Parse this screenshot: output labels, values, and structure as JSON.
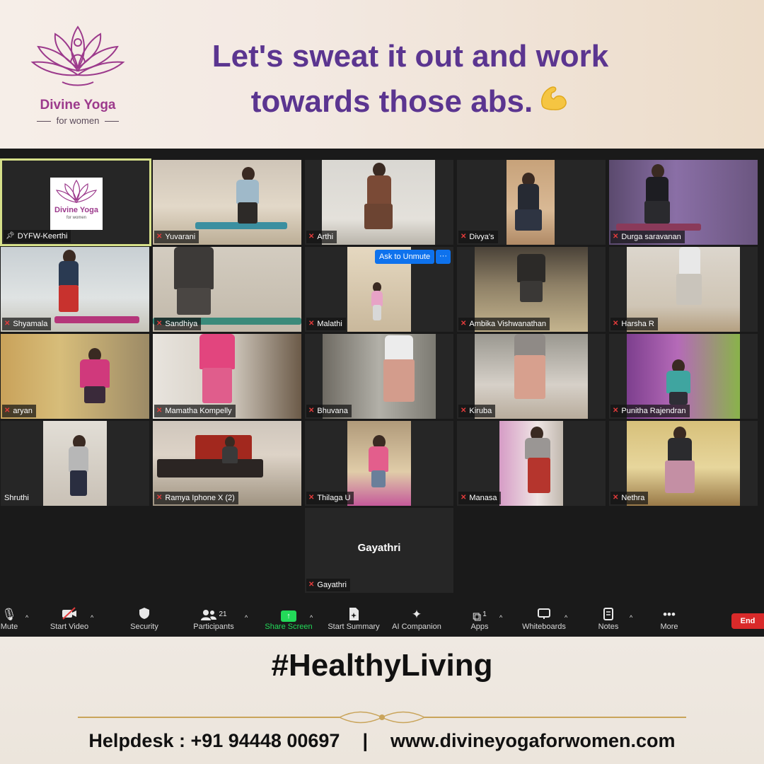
{
  "header": {
    "brand_name": "Divine Yoga",
    "brand_sub": "for women",
    "headline_line1": "Let's sweat it out and work",
    "headline_line2": "towards those abs."
  },
  "meeting": {
    "ask_to_unmute": "Ask to Unmute",
    "more_options": "···",
    "host_logo_text": "Divine Yoga",
    "host_logo_sub": "for women",
    "participants": [
      {
        "name": "DYFW-Keerthi",
        "pinned": true
      },
      {
        "name": "Yuvarani"
      },
      {
        "name": "Arthi"
      },
      {
        "name": "Divya's"
      },
      {
        "name": "Durga saravanan"
      },
      {
        "name": "Shyamala"
      },
      {
        "name": "Sandhiya"
      },
      {
        "name": "Malathi"
      },
      {
        "name": "Ambika Vishwanathan"
      },
      {
        "name": "Harsha R"
      },
      {
        "name": "aryan"
      },
      {
        "name": "Mamatha Kompelly"
      },
      {
        "name": "Bhuvana"
      },
      {
        "name": "Kiruba"
      },
      {
        "name": "Punitha Rajendran"
      },
      {
        "name": "Shruthi",
        "muted": false
      },
      {
        "name": "Ramya Iphone X (2)"
      },
      {
        "name": "Thilaga U"
      },
      {
        "name": "Manasa"
      },
      {
        "name": "Nethra"
      },
      {
        "name": "Gayathri",
        "video_off_label": "Gayathri"
      }
    ]
  },
  "toolbar": {
    "mute": "Mute",
    "start_video": "Start Video",
    "security": "Security",
    "participants": "Participants",
    "participants_count": "21",
    "share_screen": "Share Screen",
    "start_summary": "Start Summary",
    "ai_companion": "AI Companion",
    "apps": "Apps",
    "apps_count": "1",
    "whiteboards": "Whiteboards",
    "notes": "Notes",
    "more": "More",
    "end": "End"
  },
  "footer": {
    "hashtag": "#HealthyLiving",
    "helpdesk": "Helpdesk : +91 94448 00697",
    "separator": "|",
    "website": "www.divineyogaforwomen.com"
  },
  "colors": {
    "headline": "#5b3590",
    "brand": "#9c3a8c",
    "share_green": "#23d959",
    "end_red": "#d92a2a",
    "active_border": "#d6e08a",
    "zoom_bg": "#1a1a1a"
  }
}
